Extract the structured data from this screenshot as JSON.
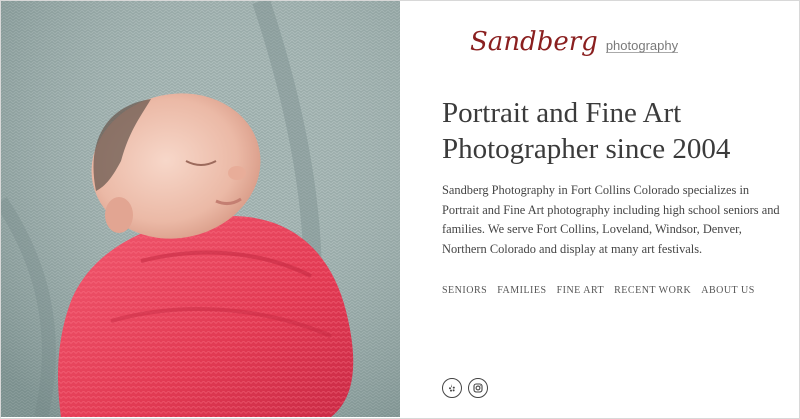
{
  "logo": {
    "script_text": "Sandberg",
    "sub_text": "photography"
  },
  "hero": {
    "headline": "Portrait and Fine Art Photographer since 2004",
    "description": "Sandberg Photography in Fort Collins Colorado specializes in Portrait and Fine Art photography including high school seniors and families. We serve Fort Collins, Loveland, Windsor, Denver, Northern Colorado and display at many art festivals."
  },
  "nav": {
    "items": [
      {
        "label": "SENIORS"
      },
      {
        "label": "FAMILIES"
      },
      {
        "label": "FINE ART"
      },
      {
        "label": "RECENT WORK"
      },
      {
        "label": "ABOUT US"
      }
    ]
  },
  "social": {
    "icons": [
      "yelp-icon",
      "instagram-icon"
    ]
  },
  "colors": {
    "logo_script": "#8a1f1f",
    "text": "#3b3b3b",
    "blanket": "#8fa3a3",
    "wrap": "#e8415a"
  }
}
